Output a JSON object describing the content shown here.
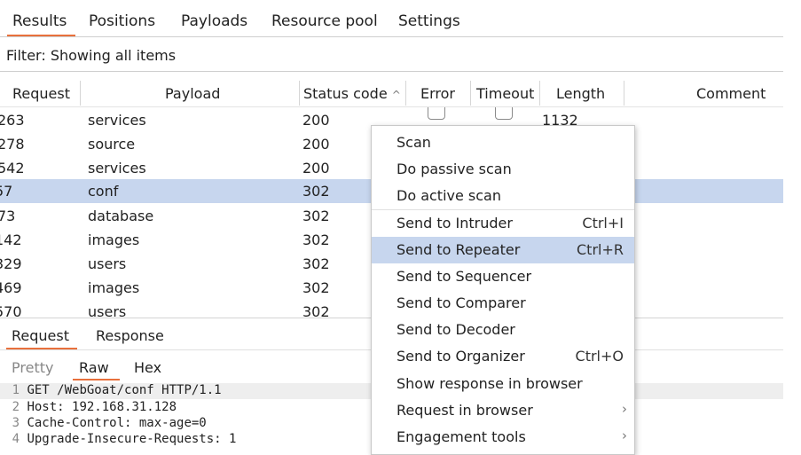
{
  "tabs": [
    "Results",
    "Positions",
    "Payloads",
    "Resource pool",
    "Settings"
  ],
  "filter": "Filter: Showing all items",
  "columns": {
    "request": "Request",
    "payload": "Payload",
    "status": "Status code",
    "sort_icon": "^",
    "error": "Error",
    "timeout": "Timeout",
    "length": "Length",
    "comment": "Comment"
  },
  "rows": [
    {
      "request": "263",
      "payload": "services",
      "status": "200",
      "length": "1132"
    },
    {
      "request": "278",
      "payload": "source",
      "status": "200",
      "length": ""
    },
    {
      "request": "542",
      "payload": "services",
      "status": "200",
      "length": ""
    },
    {
      "request": "57",
      "payload": "conf",
      "status": "302",
      "length": ""
    },
    {
      "request": "73",
      "payload": "database",
      "status": "302",
      "length": ""
    },
    {
      "request": "142",
      "payload": "images",
      "status": "302",
      "length": ""
    },
    {
      "request": "329",
      "payload": "users",
      "status": "302",
      "length": ""
    },
    {
      "request": "469",
      "payload": "images",
      "status": "302",
      "length": ""
    },
    {
      "request": "570",
      "payload": "users",
      "status": "302",
      "length": ""
    }
  ],
  "selected_row": 3,
  "panel_tabs": [
    "Request",
    "Response"
  ],
  "view_tabs": [
    "Pretty",
    "Raw",
    "Hex"
  ],
  "code_lines": [
    {
      "n": "1",
      "text": "GET /WebGoat/conf HTTP/1.1"
    },
    {
      "n": "2",
      "text": "Host: 192.168.31.128"
    },
    {
      "n": "3",
      "text": "Cache-Control: max-age=0"
    },
    {
      "n": "4",
      "text": "Upgrade-Insecure-Requests: 1"
    }
  ],
  "context_menu": [
    {
      "label": "Scan",
      "shortcut": ""
    },
    {
      "label": "Do passive scan",
      "shortcut": ""
    },
    {
      "label": "Do active scan",
      "shortcut": ""
    },
    {
      "label": "Send to Intruder",
      "shortcut": "Ctrl+I"
    },
    {
      "label": "Send to Repeater",
      "shortcut": "Ctrl+R"
    },
    {
      "label": "Send to Sequencer",
      "shortcut": ""
    },
    {
      "label": "Send to Comparer",
      "shortcut": ""
    },
    {
      "label": "Send to Decoder",
      "shortcut": ""
    },
    {
      "label": "Send to Organizer",
      "shortcut": "Ctrl+O"
    },
    {
      "label": "Show response in browser",
      "shortcut": ""
    },
    {
      "label": "Request in browser",
      "shortcut": ""
    },
    {
      "label": "Engagement tools",
      "shortcut": ""
    }
  ],
  "submenu_arrow": "›",
  "colors": {
    "accent": "#e8703c",
    "selection": "#c7d6ee"
  }
}
